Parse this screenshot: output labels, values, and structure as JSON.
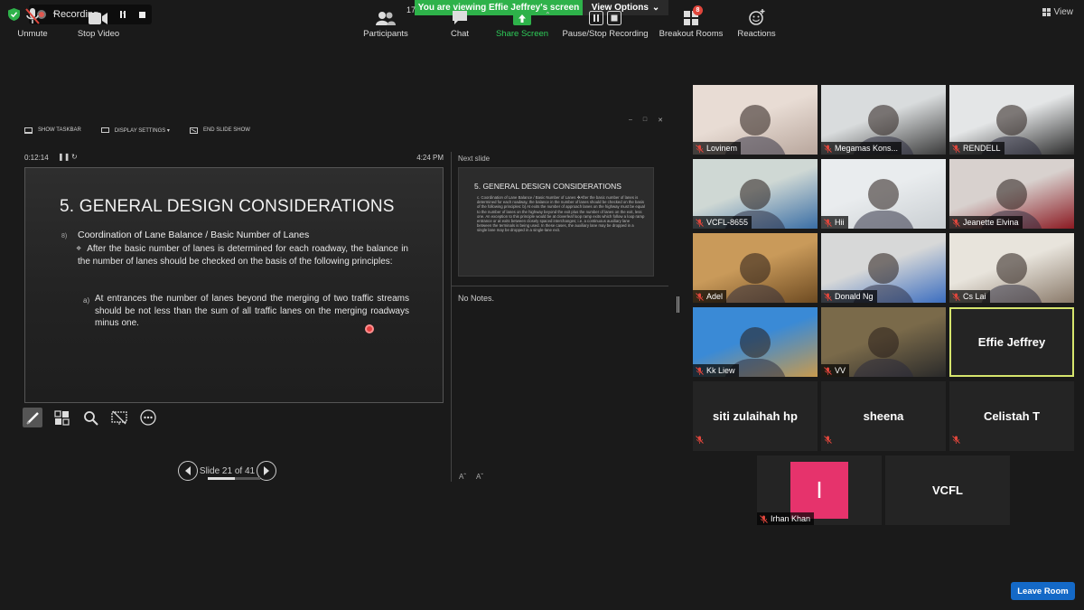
{
  "top": {
    "recording_label": "Recording...",
    "viewing_banner": "You are viewing Effie Jeffrey's screen",
    "view_options": "View Options",
    "view_label": "View"
  },
  "presenter": {
    "toolbar": [
      "SHOW TASKBAR",
      "DISPLAY SETTINGS ▾",
      "END SLIDE SHOW"
    ],
    "window_controls": [
      "–",
      "□",
      "✕"
    ],
    "timer": "0:12:14",
    "clock": "4:24 PM",
    "slide": {
      "title": "5. GENERAL DESIGN CONSIDERATIONS",
      "number": "8)",
      "subtitle": "Coordination of Lane Balance / Basic Number of Lanes",
      "marker": "❖",
      "para1": "After the basic number of lanes is determined for each roadway, the balance in the number of lanes should be checked on the basis of the following principles:",
      "item_label": "a)",
      "para2": "At entrances the number of lanes beyond the merging of two traffic streams should be not less than the sum of all traffic lanes on the merging roadways minus one."
    },
    "slide_counter": "Slide 21 of 41",
    "slide_progress": 0.51,
    "next_label": "Next slide",
    "next_slide": {
      "title": "5. GENERAL DESIGN CONSIDERATIONS",
      "text": "c. Coordination of Lane Balance / Basic Number of Lanes ❖After the basic number of lanes is determined for each roadway, the balance in the number of lanes should be checked on the basis of the following principles: b) At exits the number of approach lanes on the highway must be equal to the number of lanes on the highway beyond the exit plus the number of lanes on the exit, less one. An exception to this principle would be at cloverleaf loop ramp exits which follow a loop ramp entrance or at exits between closely spaced interchanges; i.e. a continuous auxiliary lane between the terminals is being used. In these cases, the auxiliary lane may be dropped in a single lane may be dropped in a single-lane exit."
    },
    "notes": "No Notes.",
    "font_controls": [
      "Aˆ",
      "Aˇ"
    ]
  },
  "participants": [
    {
      "name": "Lovinem",
      "kind": "video",
      "colors": [
        "#e8dcd4",
        "#b8a69c"
      ]
    },
    {
      "name": "Megamas Kons...",
      "kind": "video",
      "colors": [
        "#d9dcdd",
        "#3a3a3a"
      ]
    },
    {
      "name": "RENDELL",
      "kind": "video",
      "colors": [
        "#e4e6e7",
        "#2c2c2c"
      ]
    },
    {
      "name": "VCFL-8655",
      "kind": "video",
      "colors": [
        "#cfd8d4",
        "#3a6ea5"
      ]
    },
    {
      "name": "Hii",
      "kind": "video",
      "colors": [
        "#e9ecee",
        "#c9ced2"
      ]
    },
    {
      "name": "Jeanette Elvina",
      "kind": "video",
      "colors": [
        "#d8d1ce",
        "#8b1a22"
      ]
    },
    {
      "name": "Adel",
      "kind": "video",
      "colors": [
        "#c99a5a",
        "#6e4b22"
      ]
    },
    {
      "name": "Donald Ng",
      "kind": "video",
      "colors": [
        "#d7d8d8",
        "#3c6ec0"
      ]
    },
    {
      "name": "Cs Lai",
      "kind": "video",
      "colors": [
        "#e8e4dc",
        "#8a7a6a"
      ]
    },
    {
      "name": "Kk Liew",
      "kind": "video",
      "colors": [
        "#3a8ad6",
        "#c79a4e"
      ]
    },
    {
      "name": "VV",
      "kind": "video",
      "colors": [
        "#7a6a4a",
        "#2a2a2a"
      ]
    },
    {
      "name": "Effie Jeffrey",
      "kind": "name-active"
    },
    {
      "name": "siti zulaihah hp",
      "kind": "name"
    },
    {
      "name": "sheena",
      "kind": "name"
    },
    {
      "name": "Celistah T",
      "kind": "name"
    },
    {
      "name": "Irhan Khan",
      "kind": "avatar",
      "initial": "I",
      "avatar_color": "#e6336c"
    },
    {
      "name": "VCFL",
      "kind": "name-nomic"
    }
  ],
  "bottom_bar": {
    "unmute": "Unmute",
    "stop_video": "Stop Video",
    "participants": "Participants",
    "participants_count": "17",
    "chat": "Chat",
    "share_screen": "Share Screen",
    "pause_stop_recording": "Pause/Stop Recording",
    "breakout_rooms": "Breakout Rooms",
    "breakout_badge": "8",
    "reactions": "Reactions",
    "leave_room": "Leave Room"
  },
  "colors": {
    "background": "#1a1a1a",
    "banner_green": "#2eb24a",
    "active_speaker": "#d6e56d",
    "leave_blue": "#1469c7",
    "mic_off_red": "#e0463c"
  }
}
